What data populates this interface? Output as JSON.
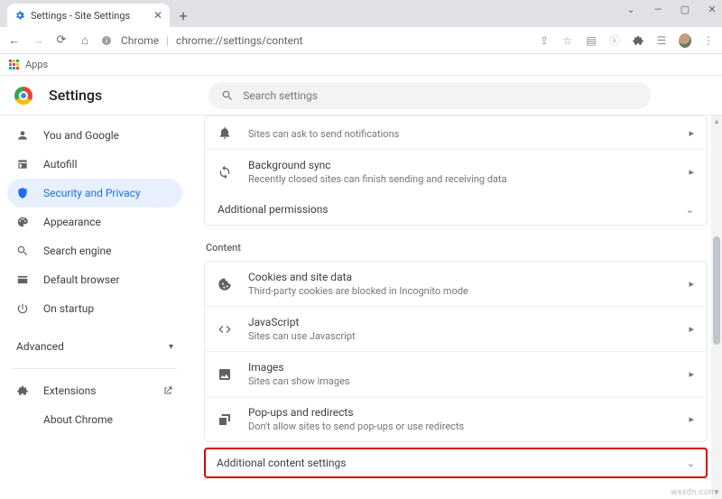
{
  "window": {
    "tab_title": "Settings - Site Settings"
  },
  "omnibox": {
    "origin_label": "Chrome",
    "url": "chrome://settings/content"
  },
  "bookmarks": {
    "apps_label": "Apps"
  },
  "header": {
    "title": "Settings"
  },
  "search": {
    "placeholder": "Search settings"
  },
  "sidebar": {
    "items": [
      {
        "label": "You and Google"
      },
      {
        "label": "Autofill"
      },
      {
        "label": "Security and Privacy"
      },
      {
        "label": "Appearance"
      },
      {
        "label": "Search engine"
      },
      {
        "label": "Default browser"
      },
      {
        "label": "On startup"
      }
    ],
    "advanced_label": "Advanced",
    "extensions_label": "Extensions",
    "about_label": "About Chrome"
  },
  "content": {
    "rows": [
      {
        "title": "",
        "sub": "Sites can ask to send notifications"
      },
      {
        "title": "Background sync",
        "sub": "Recently closed sites can finish sending and receiving data"
      }
    ],
    "additional_permissions": "Additional permissions",
    "content_label": "Content",
    "content_rows": [
      {
        "title": "Cookies and site data",
        "sub": "Third-party cookies are blocked in Incognito mode"
      },
      {
        "title": "JavaScript",
        "sub": "Sites can use Javascript"
      },
      {
        "title": "Images",
        "sub": "Sites can show images"
      },
      {
        "title": "Pop-ups and redirects",
        "sub": "Don't allow sites to send pop-ups or use redirects"
      }
    ],
    "additional_content": "Additional content settings"
  }
}
